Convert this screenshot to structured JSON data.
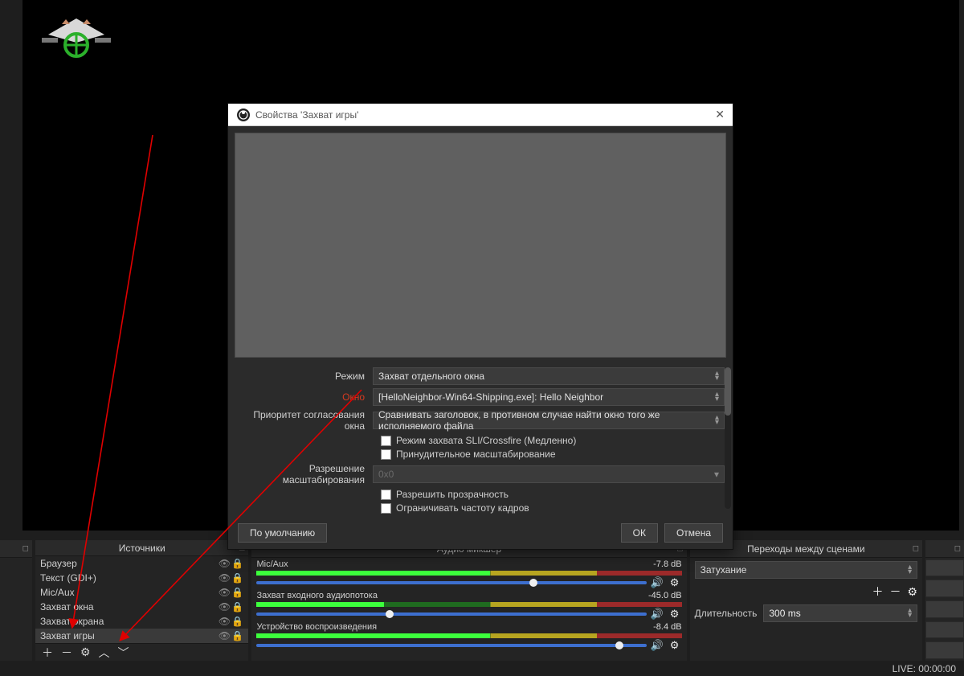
{
  "panels": {
    "sources_title": "Источники",
    "mixer_title": "Аудио микшер",
    "transitions_title": "Переходы между сценами"
  },
  "sources": {
    "items": [
      {
        "name": "Браузер"
      },
      {
        "name": "Текст (GDI+)"
      },
      {
        "name": "Mic/Aux"
      },
      {
        "name": "Захват окна"
      },
      {
        "name": "Захват экрана"
      },
      {
        "name": "Захват игры"
      }
    ]
  },
  "mixer": {
    "channels": [
      {
        "name": "Mic/Aux",
        "db": "-7.8 dB"
      },
      {
        "name": "Захват входного аудиопотока",
        "db": "-45.0 dB"
      },
      {
        "name": "Устройство воспроизведения",
        "db": "-8.4 dB"
      }
    ]
  },
  "transitions": {
    "selected": "Затухание",
    "duration_label": "Длительность",
    "duration_value": "300 ms"
  },
  "dialog": {
    "title": "Свойства 'Захват игры'",
    "labels": {
      "mode": "Режим",
      "window": "Окно",
      "window_priority": "Приоритет согласования окна",
      "scale_resolution": "Разрешение масштабирования"
    },
    "values": {
      "mode": "Захват отдельного окна",
      "window": "[HelloNeighbor-Win64-Shipping.exe]: Hello Neighbor",
      "window_priority": "Сравнивать заголовок, в противном случае найти окно того же исполняемого файла",
      "scale_resolution": "0x0"
    },
    "checkboxes": {
      "sli": "Режим захвата SLI/Crossfire (Медленно)",
      "force_scale": "Принудительное масштабирование",
      "transparency": "Разрешить прозрачность",
      "limit_fps": "Ограничивать частоту кадров"
    },
    "buttons": {
      "defaults": "По умолчанию",
      "ok": "ОК",
      "cancel": "Отмена"
    }
  },
  "status": {
    "live": "LIVE: 00:00:00"
  }
}
